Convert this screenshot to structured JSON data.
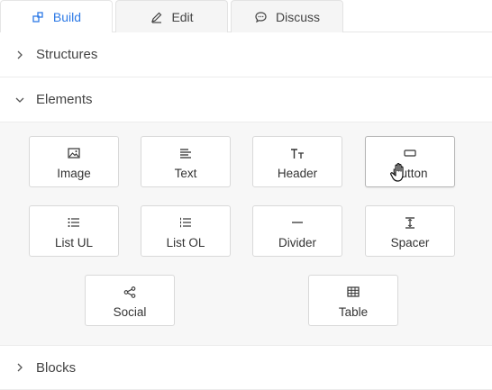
{
  "tabs": [
    {
      "label": "Build",
      "active": true,
      "icon": "blocks-icon"
    },
    {
      "label": "Edit",
      "active": false,
      "icon": "pen-icon"
    },
    {
      "label": "Discuss",
      "active": false,
      "icon": "chat-icon"
    }
  ],
  "sections": {
    "structures": {
      "label": "Structures",
      "expanded": false
    },
    "elements": {
      "label": "Elements",
      "expanded": true
    },
    "blocks": {
      "label": "Blocks",
      "expanded": false
    }
  },
  "elements": [
    {
      "label": "Image",
      "icon": "image-icon"
    },
    {
      "label": "Text",
      "icon": "text-align-icon"
    },
    {
      "label": "Header",
      "icon": "heading-icon"
    },
    {
      "label": "Button",
      "icon": "button-icon"
    },
    {
      "label": "List UL",
      "icon": "bullet-list-icon"
    },
    {
      "label": "List OL",
      "icon": "numbered-list-icon"
    },
    {
      "label": "Divider",
      "icon": "divider-icon"
    },
    {
      "label": "Spacer",
      "icon": "spacer-icon"
    },
    {
      "label": "Social",
      "icon": "share-icon"
    },
    {
      "label": "Table",
      "icon": "table-icon"
    }
  ],
  "colors": {
    "accent": "#2d7ae6",
    "panel_bg": "#f7f7f7",
    "border": "#d9d9d9"
  }
}
